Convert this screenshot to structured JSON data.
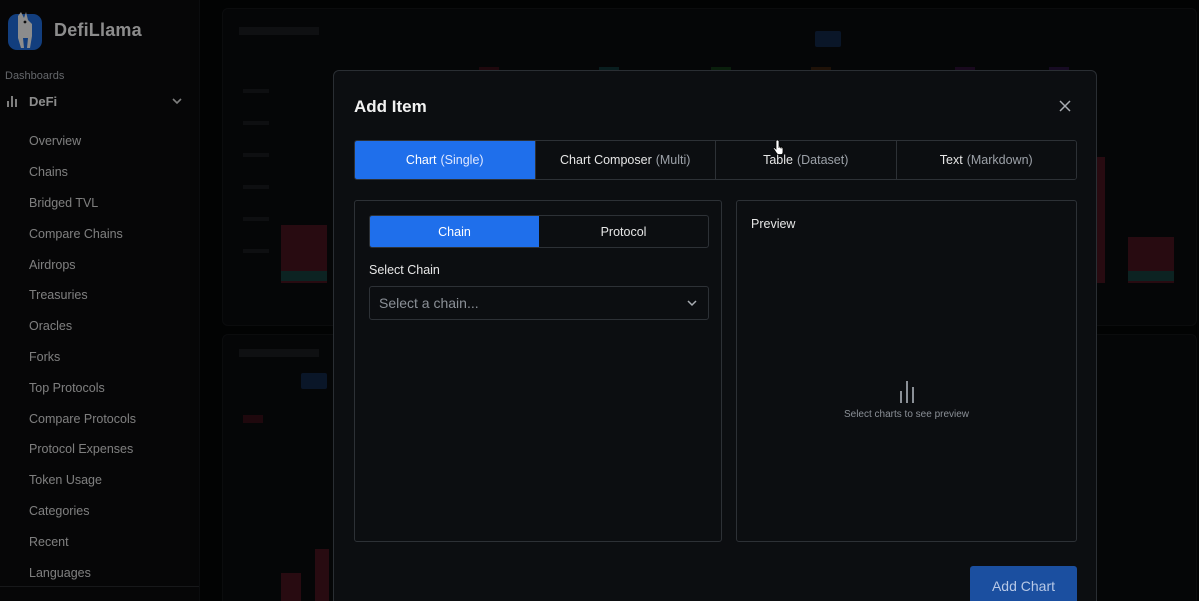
{
  "sidebar": {
    "brand": "DefiLlama",
    "section_label": "Dashboards",
    "group_label": "DeFi",
    "items": [
      {
        "label": "Overview"
      },
      {
        "label": "Chains"
      },
      {
        "label": "Bridged TVL"
      },
      {
        "label": "Compare Chains"
      },
      {
        "label": "Airdrops"
      },
      {
        "label": "Treasuries"
      },
      {
        "label": "Oracles"
      },
      {
        "label": "Forks"
      },
      {
        "label": "Top Protocols"
      },
      {
        "label": "Compare Protocols"
      },
      {
        "label": "Protocol Expenses"
      },
      {
        "label": "Token Usage"
      },
      {
        "label": "Categories"
      },
      {
        "label": "Recent"
      },
      {
        "label": "Languages"
      }
    ]
  },
  "modal": {
    "title": "Add Item",
    "type_tabs": [
      {
        "label": "Chart",
        "sub": "(Single)"
      },
      {
        "label": "Chart Composer",
        "sub": "(Multi)"
      },
      {
        "label": "Table",
        "sub": "(Dataset)"
      },
      {
        "label": "Text",
        "sub": "(Markdown)"
      }
    ],
    "sub_tabs": [
      {
        "label": "Chain"
      },
      {
        "label": "Protocol"
      }
    ],
    "select_label": "Select Chain",
    "select_placeholder": "Select a chain...",
    "preview_title": "Preview",
    "preview_empty": "Select charts to see preview",
    "submit_label": "Add Chart"
  },
  "colors": {
    "accent": "#1f6feb",
    "submit_disabled": "#1b4fa0",
    "background": "#000000",
    "panel_border": "#2d3136"
  },
  "icons": {
    "brand": "llama-logo",
    "group": "bar-chart-icon",
    "group_toggle": "chevron-down-icon",
    "close": "close-icon",
    "select_toggle": "chevron-down-icon",
    "preview": "bar-chart-icon"
  }
}
